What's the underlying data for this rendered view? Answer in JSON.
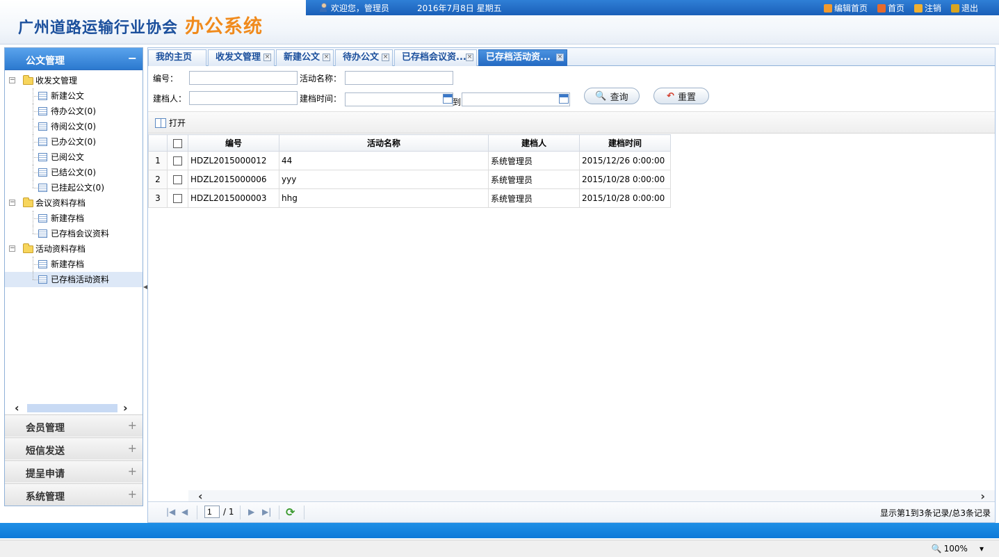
{
  "header": {
    "logo_main": "广州道路运输行业协会",
    "logo_sub": "办公系统",
    "welcome": "欢迎您，管理员",
    "date": "2016年7月8日  星期五",
    "links": [
      {
        "label": "编辑首页",
        "icon": "grid-icon",
        "color": "#f29a2e"
      },
      {
        "label": "首页",
        "icon": "home-icon",
        "color": "#e66a2c"
      },
      {
        "label": "注销",
        "icon": "logout-icon",
        "color": "#f0b030"
      },
      {
        "label": "退出",
        "icon": "exit-icon",
        "color": "#d9a520"
      }
    ]
  },
  "sidebar": {
    "active_section": "公文管理",
    "tree": [
      {
        "type": "folder",
        "label": "收发文管理"
      },
      {
        "type": "doc",
        "label": "新建公文"
      },
      {
        "type": "doc",
        "label": "待办公文(0)"
      },
      {
        "type": "doc",
        "label": "待阅公文(0)"
      },
      {
        "type": "doc",
        "label": "已办公文(0)"
      },
      {
        "type": "doc",
        "label": "已阅公文"
      },
      {
        "type": "doc",
        "label": "已结公文(0)"
      },
      {
        "type": "doc",
        "label": "已挂起公文(0)"
      },
      {
        "type": "folder",
        "label": "会议资料存档"
      },
      {
        "type": "doc",
        "label": "新建存档"
      },
      {
        "type": "doc",
        "label": "已存档会议资料"
      },
      {
        "type": "folder",
        "label": "活动资料存档"
      },
      {
        "type": "doc",
        "label": "新建存档"
      },
      {
        "type": "doc",
        "label": "已存档活动资料",
        "selected": true
      }
    ],
    "sections": [
      "会员管理",
      "短信发送",
      "提呈申请",
      "系统管理"
    ]
  },
  "tabs": [
    {
      "label": "我的主页",
      "closable": false
    },
    {
      "label": "收发文管理",
      "closable": true
    },
    {
      "label": "新建公文",
      "closable": true
    },
    {
      "label": "待办公文",
      "closable": true
    },
    {
      "label": "已存档会议资...",
      "closable": true
    },
    {
      "label": "已存档活动资...",
      "closable": true,
      "active": true
    }
  ],
  "search": {
    "code_label": "编号：",
    "code_value": "",
    "name_label": "活动名称：",
    "name_value": "",
    "creator_label": "建档人：",
    "creator_value": "",
    "time_label": "建档时间：",
    "time_from": "",
    "to_label": "到",
    "time_to": "",
    "query_button": "查询",
    "reset_button": "重置"
  },
  "toolbar": {
    "open_label": "打开"
  },
  "grid": {
    "columns": [
      "编号",
      "活动名称",
      "建档人",
      "建档时间"
    ],
    "rows": [
      {
        "num": "1",
        "code": "HDZL2015000012",
        "name": "44",
        "creator": "系统管理员",
        "time": "2015/12/26 0:00:00"
      },
      {
        "num": "2",
        "code": "HDZL2015000006",
        "name": "yyy",
        "creator": "系统管理员",
        "time": "2015/10/28 0:00:00"
      },
      {
        "num": "3",
        "code": "HDZL2015000003",
        "name": "hhg",
        "creator": "系统管理员",
        "time": "2015/10/28 0:00:00"
      }
    ]
  },
  "pager": {
    "page": "1",
    "total": "/ 1",
    "info": "显示第1到3条记录/总3条记录"
  },
  "status": {
    "zoom": "100%"
  }
}
